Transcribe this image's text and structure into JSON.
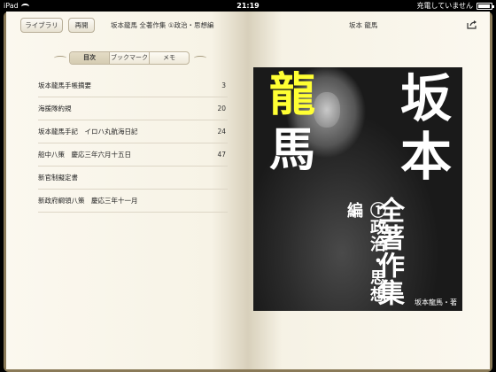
{
  "status": {
    "device": "iPad",
    "time": "21:19",
    "battery_text": "充電していません",
    "battery_level": 0.9
  },
  "toolbar": {
    "library_label": "ライブラリ",
    "resume_label": "再開",
    "book_title": "坂本龍馬 全著作集 ①政治・思想編",
    "right_title": "坂本 龍馬",
    "share_icon": "share-icon"
  },
  "tabs": [
    {
      "label": "目次",
      "active": true
    },
    {
      "label": "ブックマーク",
      "active": false
    },
    {
      "label": "メモ",
      "active": false
    }
  ],
  "toc": [
    {
      "title": "坂本龍馬手帳摘要",
      "page": "3"
    },
    {
      "title": "海援隊約規",
      "page": "20"
    },
    {
      "title": "坂本龍馬手記　イロハ丸航海日記",
      "page": "24"
    },
    {
      "title": "船中八策　慶応三年六月十五日",
      "page": "47"
    },
    {
      "title": "新官制擬定書",
      "page": ""
    },
    {
      "title": "新政府綱領八策　慶応三年十一月",
      "page": ""
    }
  ],
  "cover": {
    "char1": "龍",
    "char2": "馬",
    "char3": "坂",
    "char4": "本",
    "subtitle": "全著作集",
    "volume": "①政治・思想編",
    "author": "坂本龍馬・著",
    "accent_yellow": "#ffff33"
  }
}
